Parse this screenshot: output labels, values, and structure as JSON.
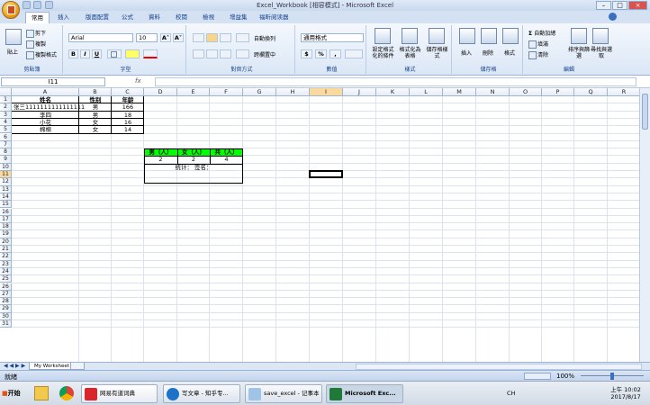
{
  "window": {
    "title": "Excel_Workbook [相容模式] - Microsoft Excel"
  },
  "win_controls": {
    "minimize": "–",
    "maximize": "□",
    "close": "×"
  },
  "tabs": [
    "常用",
    "插入",
    "版面配置",
    "公式",
    "資料",
    "校閱",
    "檢視",
    "增益集",
    "福昕阅读器"
  ],
  "ribbon": {
    "clipboard": {
      "paste": "貼上",
      "cut": "剪下",
      "copy": "複製",
      "format_painter": "複製格式",
      "label": "剪貼簿"
    },
    "font": {
      "name": "Arial",
      "size": "10",
      "grow": "A˄",
      "shrink": "A˅",
      "bold": "B",
      "italic": "I",
      "underline": "U",
      "label": "字型"
    },
    "alignment": {
      "wrap": "自動換列",
      "merge": "跨欄置中",
      "label": "對齊方式"
    },
    "number": {
      "format": "通用格式",
      "currency": "$",
      "percent": "%",
      "comma": ",",
      "label": "數值"
    },
    "styles": {
      "conditional": "設定格式化的條件",
      "table": "格式化為表格",
      "cell": "儲存格樣式",
      "label": "樣式"
    },
    "cells": {
      "insert": "插入",
      "delete": "刪除",
      "format": "格式",
      "label": "儲存格"
    },
    "editing": {
      "autosum": "自動加總",
      "fill": "填滿",
      "clear": "清除",
      "sort": "排序與篩選",
      "find": "尋找與選取",
      "label": "編輯"
    }
  },
  "formula_bar": {
    "name_box": "I11",
    "fx": "fx",
    "formula": ""
  },
  "columns": [
    "A",
    "B",
    "C",
    "D",
    "E",
    "F",
    "G",
    "H",
    "I",
    "J",
    "K",
    "L",
    "M",
    "N",
    "O",
    "P",
    "Q",
    "R"
  ],
  "rows": [
    "1",
    "2",
    "3",
    "4",
    "5",
    "6",
    "7",
    "8",
    "9",
    "10",
    "11",
    "12",
    "13",
    "14",
    "15",
    "16",
    "17",
    "18",
    "19",
    "20",
    "21",
    "22",
    "23",
    "24",
    "25",
    "26",
    "27",
    "28",
    "29",
    "30",
    "31"
  ],
  "selected_row": "11",
  "selected_col": "I",
  "table1": {
    "headers": [
      "姓名",
      "性别",
      "年龄"
    ],
    "rows": [
      [
        "张三1111111111111111",
        "男",
        "166"
      ],
      [
        "李四",
        "男",
        "18"
      ],
      [
        "小花",
        "女",
        "16"
      ],
      [
        "棉棉",
        "女",
        "14"
      ]
    ]
  },
  "table2": {
    "headers": [
      "男（人）",
      "女（人）",
      "共（人）"
    ],
    "values": [
      "2",
      "2",
      "4"
    ],
    "footer": "统计：   签名：",
    "header_bg": "#00ff00"
  },
  "sheet_tab": "My Worksheet",
  "status": {
    "ready": "就緒",
    "zoom": "100%"
  },
  "taskbar": {
    "start": "开始",
    "items": [
      "网易有道词典",
      "写文章 - 知乎专...",
      "save_excel - 记事本",
      "Microsoft Exc..."
    ],
    "tray_lang": "CH",
    "time": "上午 10:02",
    "date": "2017/8/17"
  }
}
